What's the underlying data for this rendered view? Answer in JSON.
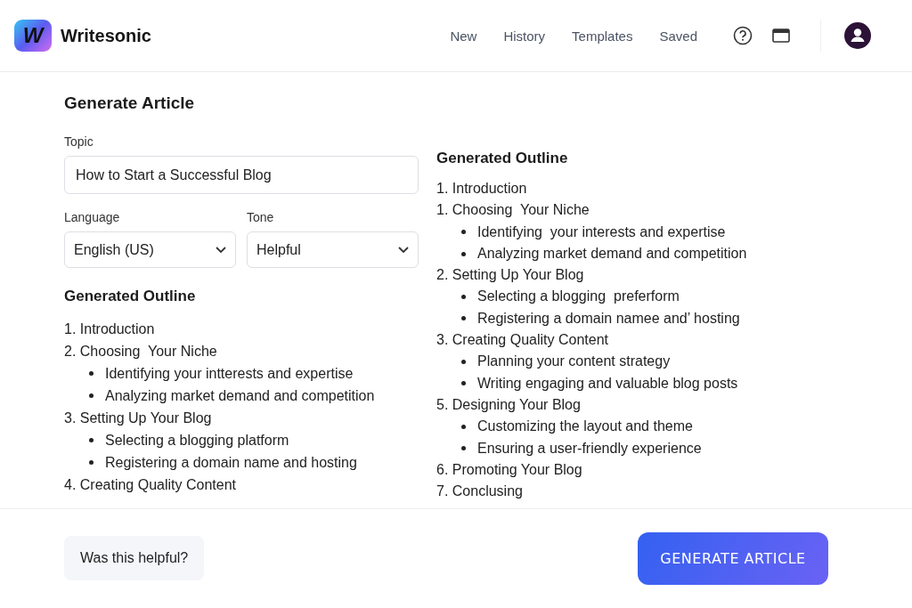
{
  "brand": {
    "name": "Writesonic",
    "logo_letter": "W"
  },
  "nav": [
    "New",
    "History",
    "Templates",
    "Saved"
  ],
  "form": {
    "title": "Generate Article",
    "topic_label": "Topic",
    "topic_value": "How to Start a Successful Blog",
    "language_label": "Language",
    "language_value": "English (US)",
    "tone_label": "Tone",
    "tone_value": "Helpful"
  },
  "left_outline": {
    "title": "Generated Outline",
    "items": [
      {
        "text": "1. Introduction"
      },
      {
        "text": "2. Choosing  Your Niche",
        "children": [
          {
            "text": "Identifying your intterests and expertise"
          },
          {
            "text": "Analyzing market demand and competition"
          }
        ]
      },
      {
        "text": "3. Setting Up Your Blog",
        "children": [
          {
            "text": "Selecting a blogging platform"
          },
          {
            "text": "Registering a domain name and hosting"
          }
        ]
      },
      {
        "text": "4. Creating Quality Content"
      }
    ]
  },
  "right_outline": {
    "title": "Generated Outline",
    "items": [
      {
        "text": "1. Introduction"
      },
      {
        "text": "1. Choosing  Your Niche",
        "children": [
          {
            "text": "Identifying  your interests and expertise"
          },
          {
            "text": "Analyzing market demand and competition"
          }
        ]
      },
      {
        "text": "2. Setting Up Your Blog",
        "children": [
          {
            "text": "Selecting a blogging  preferform"
          },
          {
            "text": "Registering a domain namee and’ hosting"
          }
        ]
      },
      {
        "text": "3. Creating Quality Content",
        "children": [
          {
            "text": "Planning your content strategy"
          },
          {
            "text": "Writing engaging and valuable blog posts"
          }
        ]
      },
      {
        "text": "5. Designing Your Blog",
        "children": [
          {
            "text": "Customizing the layout and theme"
          },
          {
            "text": "Ensuring a user-friendly experience"
          }
        ]
      },
      {
        "text": "6. Promoting Your Blog"
      },
      {
        "text": "7. Conclusing"
      }
    ]
  },
  "footer": {
    "feedback": "Was this helpful?",
    "action": "GENERATE ARTICLE"
  }
}
